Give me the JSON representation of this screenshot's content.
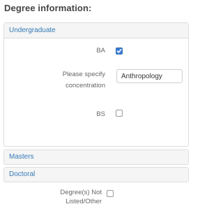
{
  "section": {
    "title": "Degree information:"
  },
  "panels": {
    "undergraduate": {
      "header": "Undergraduate",
      "fields": {
        "ba": {
          "label": "BA",
          "checked": true
        },
        "concentration": {
          "label_line1": "Please specify",
          "label_line2": "concentration",
          "value": "Anthropology"
        },
        "bs": {
          "label": "BS",
          "checked": false
        }
      }
    },
    "masters": {
      "header": "Masters"
    },
    "doctoral": {
      "header": "Doctoral"
    }
  },
  "other": {
    "label_line1": "Degree(s) Not",
    "label_line2": "Listed/Other",
    "checked": false
  },
  "colors": {
    "link": "#337ab7",
    "checkbox_checked": "#3b7fd4"
  }
}
